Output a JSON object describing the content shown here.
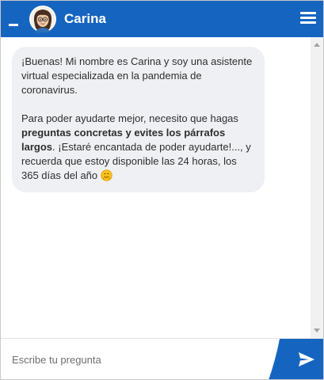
{
  "header": {
    "title": "Carina",
    "background": "#1565c0",
    "minimize_icon": "minimize-icon",
    "menu_icon": "hamburger-menu-icon"
  },
  "message": {
    "p1": "¡Buenas! Mi nombre es Carina y soy una asistente virtual especializada en la pandemia de coronavirus.",
    "p2_start": "Para poder ayudarte mejor, necesito que hagas ",
    "p2_bold": "preguntas concretas y evites los párrafos largos",
    "p2_end": ". ¡Estaré encantada de poder ayudarte!..., y recuerda que estoy disponible las 24 horas, los 365 días del año",
    "emoji": "hugging-face-emoji",
    "bubble_color": "#eef0f3"
  },
  "footer": {
    "placeholder": "Escribe tu pregunta",
    "send_icon": "send-icon",
    "accent": "#1565c0"
  }
}
